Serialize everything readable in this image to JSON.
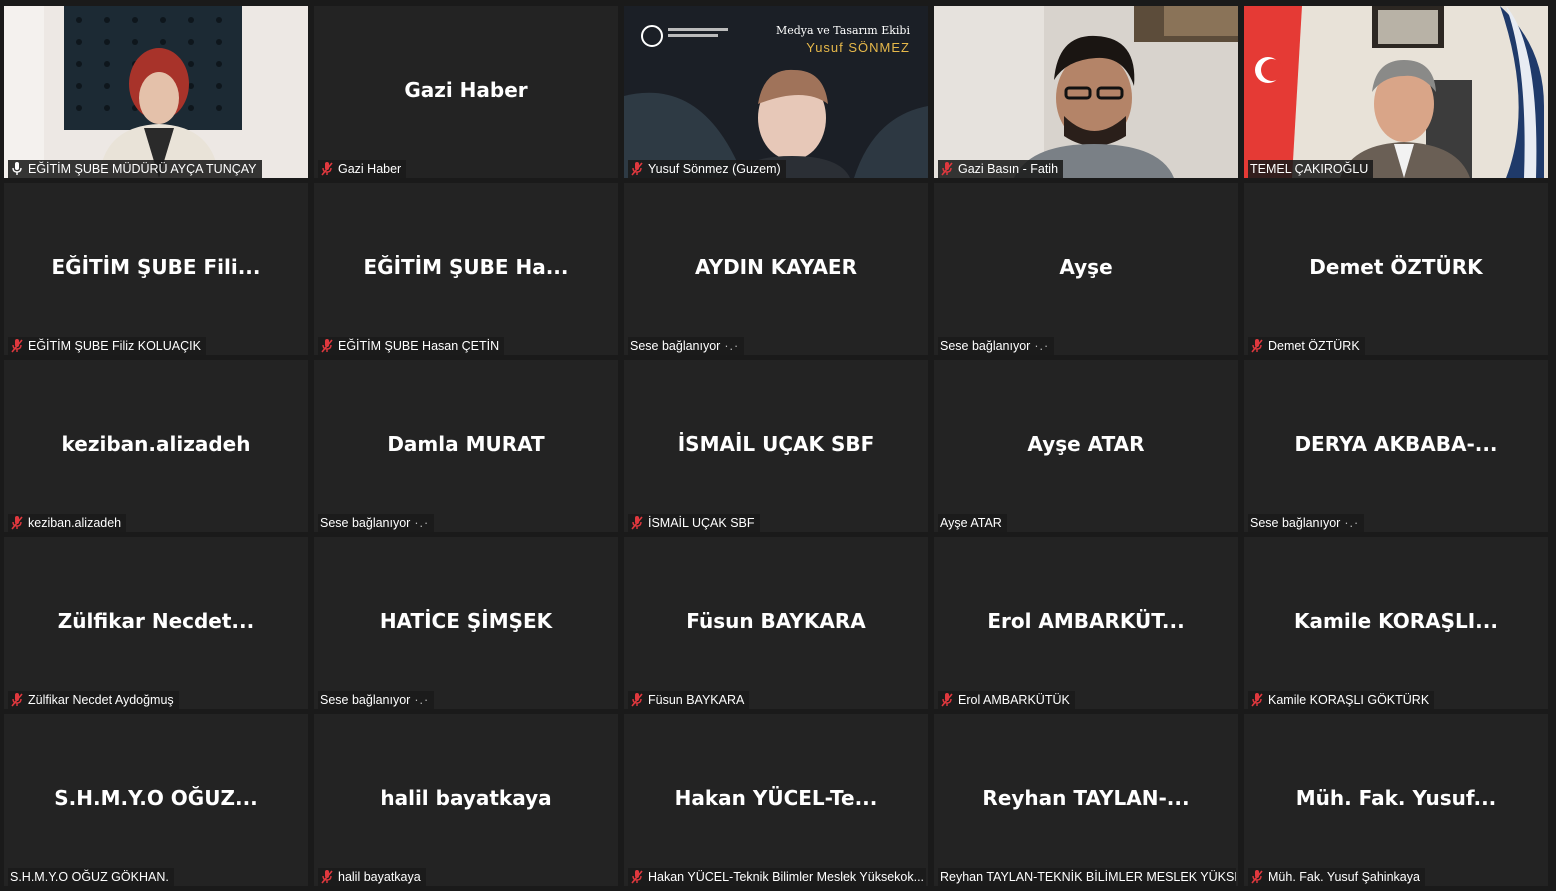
{
  "colors": {
    "active_border": "#d7ea4a",
    "tile_bg": "#232323",
    "mute_red": "#e0383e"
  },
  "tiles": [
    {
      "big": "",
      "label": "EĞİTİM ŞUBE MÜDÜRÜ AYÇA TUNÇAY",
      "icon": "speaker-icon",
      "video": "v1",
      "active": true
    },
    {
      "big": "Gazi Haber",
      "label": "Gazi Haber",
      "icon": "mic-muted-icon"
    },
    {
      "big": "",
      "label": "Yusuf Sönmez (Guzem)",
      "icon": "mic-muted-icon",
      "video": "v3",
      "banner_title": "Medya ve Tasarım Ekibi",
      "banner_name": "Yusuf SÖNMEZ"
    },
    {
      "big": "",
      "label": "Gazi Basın - Fatih",
      "icon": "mic-muted-icon",
      "video": "v4"
    },
    {
      "big": "",
      "label": "TEMEL ÇAKIROĞLU",
      "icon": "",
      "video": "v5"
    },
    {
      "big": "EĞİTİM ŞUBE Fili...",
      "label": "EĞİTİM ŞUBE Filiz KOLUAÇIK",
      "icon": "mic-muted-icon"
    },
    {
      "big": "EĞİTİM ŞUBE Ha...",
      "label": "EĞİTİM ŞUBE Hasan ÇETİN",
      "icon": "mic-muted-icon"
    },
    {
      "big": "AYDIN KAYAER",
      "label": "Sese bağlanıyor",
      "icon": "",
      "connecting": true
    },
    {
      "big": "Ayşe",
      "label": "Sese bağlanıyor",
      "icon": "",
      "connecting": true
    },
    {
      "big": "Demet ÖZTÜRK",
      "label": "Demet ÖZTÜRK",
      "icon": "mic-muted-icon"
    },
    {
      "big": "keziban.alizadeh",
      "label": "keziban.alizadeh",
      "icon": "mic-muted-icon"
    },
    {
      "big": "Damla MURAT",
      "label": "Sese bağlanıyor",
      "icon": "",
      "connecting": true
    },
    {
      "big": "İSMAİL UÇAK SBF",
      "label": "İSMAİL UÇAK SBF",
      "icon": "mic-muted-icon"
    },
    {
      "big": "Ayşe ATAR",
      "label": "Ayşe ATAR",
      "icon": ""
    },
    {
      "big": "DERYA  AKBABA-...",
      "label": "Sese bağlanıyor",
      "icon": "",
      "connecting": true
    },
    {
      "big": "Zülfikar  Necdet...",
      "label": "Zülfikar Necdet Aydoğmuş",
      "icon": "mic-muted-icon"
    },
    {
      "big": "HATİCE ŞİMŞEK",
      "label": "Sese bağlanıyor",
      "icon": "",
      "connecting": true
    },
    {
      "big": "Füsun BAYKARA",
      "label": "Füsun BAYKARA",
      "icon": "mic-muted-icon"
    },
    {
      "big": "Erol  AMBARKÜT...",
      "label": "Erol AMBARKÜTÜK",
      "icon": "mic-muted-icon"
    },
    {
      "big": "Kamile  KORAŞLI...",
      "label": "Kamile KORAŞLI GÖKTÜRK",
      "icon": "mic-muted-icon"
    },
    {
      "big": "S.H.M.Y.O  OĞUZ...",
      "label": "S.H.M.Y.O OĞUZ GÖKHAN.",
      "icon": ""
    },
    {
      "big": "halil bayatkaya",
      "label": "halil bayatkaya",
      "icon": "mic-muted-icon"
    },
    {
      "big": "Hakan  YÜCEL-Te...",
      "label": "Hakan YÜCEL-Teknik Bilimler Meslek Yüksekok...",
      "icon": "mic-muted-icon"
    },
    {
      "big": "Reyhan  TAYLAN-...",
      "label": "Reyhan TAYLAN-TEKNİK BİLİMLER MESLEK YÜKSE...",
      "icon": ""
    },
    {
      "big": "Müh.  Fak.  Yusuf...",
      "label": "Müh. Fak. Yusuf Şahinkaya",
      "icon": "mic-muted-icon"
    }
  ]
}
